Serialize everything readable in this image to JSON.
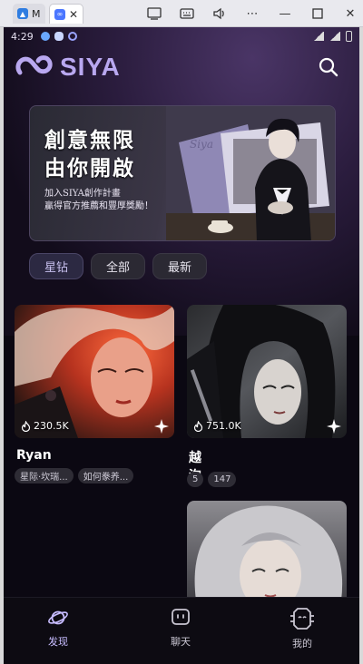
{
  "browser": {
    "tabs": [
      {
        "label": "M"
      },
      {
        "close": "✕"
      }
    ]
  },
  "status_bar": {
    "time": "4:29"
  },
  "header": {
    "logo_text": "SIYA"
  },
  "banner": {
    "title_line1": "創意無限",
    "title_line2": "由你開啟",
    "subtitle_line1": "加入SIYA創作計畫",
    "subtitle_line2": "贏得官方推薦和豐厚獎勵！",
    "card_label": "Siya"
  },
  "filters": [
    {
      "label": "星钻",
      "active": true
    },
    {
      "label": "全部",
      "active": false
    },
    {
      "label": "最新",
      "active": false
    }
  ],
  "cards": [
    {
      "name": "Ryan",
      "hot": "230.5K",
      "tags": [
        "星际·坎瑞...",
        "如何豢养..."
      ]
    },
    {
      "name": "越洵",
      "hot": "751.0K",
      "tags": [
        "5",
        "147"
      ]
    },
    {
      "name": "",
      "hot": "",
      "tags": []
    }
  ],
  "bottom_nav": [
    {
      "label": "发现",
      "active": true
    },
    {
      "label": "聊天",
      "active": false
    },
    {
      "label": "我的",
      "active": false
    }
  ],
  "colors": {
    "accent": "#b9a8f0",
    "background": "#0b0812",
    "chip": "#2b2933"
  }
}
